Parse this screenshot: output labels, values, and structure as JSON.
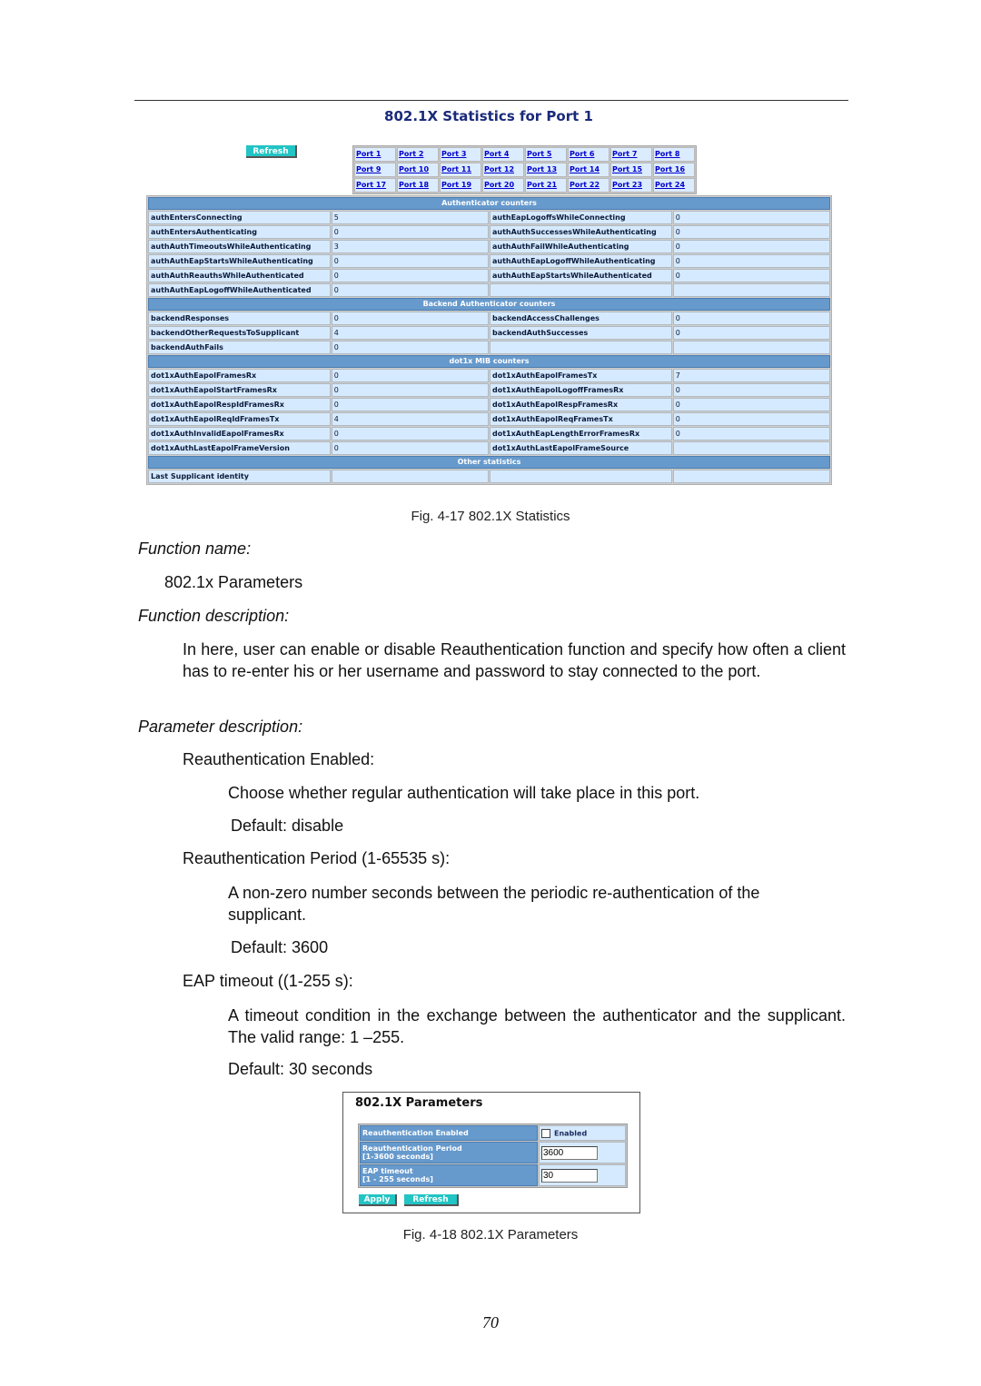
{
  "figure1": {
    "title": "802.1X Statistics for Port 1",
    "refresh_label": "Refresh",
    "ports": [
      [
        "Port 1",
        "Port 2",
        "Port 3",
        "Port 4",
        "Port 5",
        "Port 6",
        "Port 7",
        "Port 8"
      ],
      [
        "Port 9",
        "Port 10",
        "Port 11",
        "Port 12",
        "Port 13",
        "Port 14",
        "Port 15",
        "Port 16"
      ],
      [
        "Port 17",
        "Port 18",
        "Port 19",
        "Port 20",
        "Port 21",
        "Port 22",
        "Port 23",
        "Port 24"
      ]
    ],
    "sections": {
      "authenticator": {
        "header": "Authenticator counters",
        "rows": [
          {
            "l1": "authEntersConnecting",
            "v1": "5",
            "l2": "authEapLogoffsWhileConnecting",
            "v2": "0"
          },
          {
            "l1": "authEntersAuthenticating",
            "v1": "0",
            "l2": "authAuthSuccessesWhileAuthenticating",
            "v2": "0"
          },
          {
            "l1": "authAuthTimeoutsWhileAuthenticating",
            "v1": "3",
            "l2": "authAuthFailWhileAuthenticating",
            "v2": "0"
          },
          {
            "l1": "authAuthEapStartsWhileAuthenticating",
            "v1": "0",
            "l2": "authAuthEapLogoffWhileAuthenticating",
            "v2": "0"
          },
          {
            "l1": "authAuthReauthsWhileAuthenticated",
            "v1": "0",
            "l2": "authAuthEapStartsWhileAuthenticated",
            "v2": "0"
          },
          {
            "l1": "authAuthEapLogoffWhileAuthenticated",
            "v1": "0",
            "l2": "",
            "v2": ""
          }
        ]
      },
      "backend": {
        "header": "Backend Authenticator counters",
        "rows": [
          {
            "l1": "backendResponses",
            "v1": "0",
            "l2": "backendAccessChallenges",
            "v2": "0"
          },
          {
            "l1": "backendOtherRequestsToSupplicant",
            "v1": "4",
            "l2": "backendAuthSuccesses",
            "v2": "0"
          },
          {
            "l1": "backendAuthFails",
            "v1": "0",
            "l2": "",
            "v2": ""
          }
        ]
      },
      "mib": {
        "header": "dot1x MIB counters",
        "rows": [
          {
            "l1": "dot1xAuthEapolFramesRx",
            "v1": "0",
            "l2": "dot1xAuthEapolFramesTx",
            "v2": "7"
          },
          {
            "l1": "dot1xAuthEapolStartFramesRx",
            "v1": "0",
            "l2": "dot1xAuthEapolLogoffFramesRx",
            "v2": "0"
          },
          {
            "l1": "dot1xAuthEapolRespIdFramesRx",
            "v1": "0",
            "l2": "dot1xAuthEapolRespFramesRx",
            "v2": "0"
          },
          {
            "l1": "dot1xAuthEapolReqIdFramesTx",
            "v1": "4",
            "l2": "dot1xAuthEapolReqFramesTx",
            "v2": "0"
          },
          {
            "l1": "dot1xAuthInvalidEapolFramesRx",
            "v1": "0",
            "l2": "dot1xAuthEapLengthErrorFramesRx",
            "v2": "0"
          },
          {
            "l1": "dot1xAuthLastEapolFrameVersion",
            "v1": "0",
            "l2": "dot1xAuthLastEapolFrameSource",
            "v2": ""
          }
        ]
      },
      "other": {
        "header": "Other statistics",
        "rows": [
          {
            "l1": "Last Supplicant identity",
            "v1": "",
            "l2": "",
            "v2": ""
          }
        ]
      }
    },
    "caption": "Fig. 4-17 802.1X Statistics"
  },
  "text": {
    "function_name_heading": "Function name:",
    "function_name": "802.1x Parameters",
    "function_description_heading": "Function description:",
    "function_description": "In here, user can enable or disable Reauthentication function and specify how often a client has to re-enter his or her username and password to stay connected to the port.",
    "parameter_description_heading": "Parameter description:",
    "params": [
      {
        "name": "Reauthentication Enabled:",
        "desc": "Choose whether regular authentication will take place in this port.",
        "default": "Default: disable"
      },
      {
        "name": "Reauthentication Period (1-65535 s):",
        "desc": "A non-zero number seconds between the periodic re-authentication of the supplicant.",
        "default": "Default: 3600"
      },
      {
        "name": "EAP timeout ((1-255 s):",
        "desc": "A timeout condition in the exchange between the authenticator and the supplicant. The valid range: 1 –255.",
        "default": "Default: 30 seconds"
      }
    ]
  },
  "figure2": {
    "title": "802.1X Parameters",
    "rows": {
      "reauth_enabled_label": "Reauthentication Enabled",
      "reauth_enabled_checkbox_label": "Enabled",
      "reauth_enabled_checked": false,
      "reauth_period_label": "Reauthentication Period",
      "reauth_period_range": "[1-3600 seconds]",
      "reauth_period_value": "3600",
      "eap_timeout_label": "EAP timeout",
      "eap_timeout_range": "[1 - 255 seconds]",
      "eap_timeout_value": "30"
    },
    "apply_label": "Apply",
    "refresh_label": "Refresh",
    "caption": "Fig. 4-18 802.1X Parameters"
  },
  "page_number": "70",
  "colors": {
    "header_blue": "#6699cc",
    "cell_light_blue": "#d6eaff",
    "button_teal": "#22c4c4",
    "link_blue": "#0000cc",
    "title_navy": "#1a2a7a"
  }
}
